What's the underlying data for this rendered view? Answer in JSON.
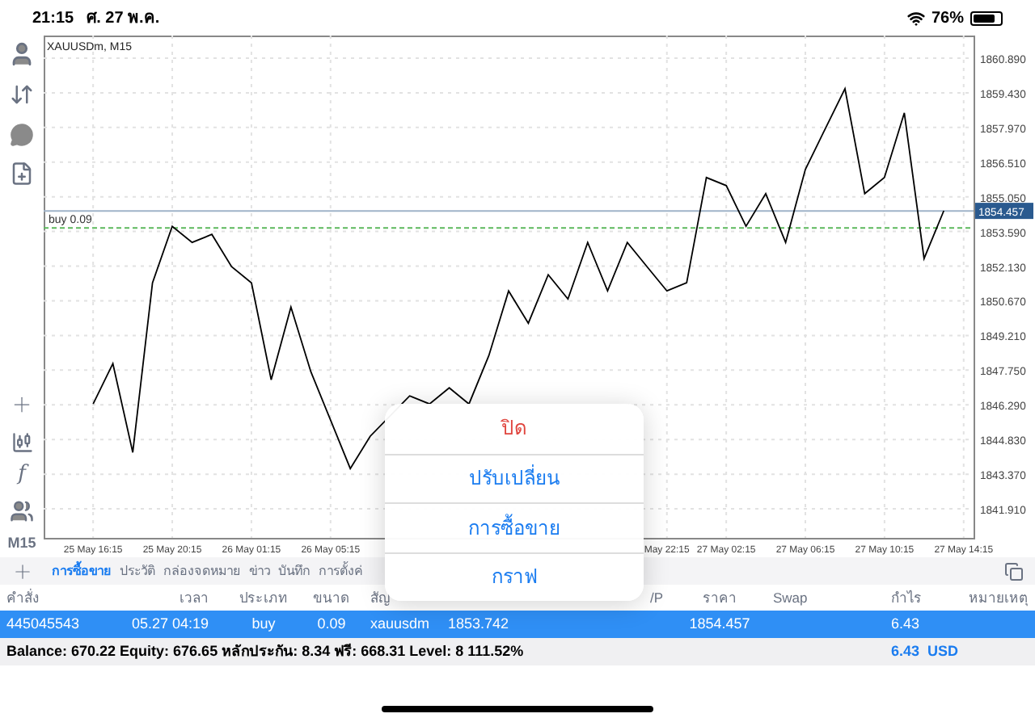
{
  "status_bar": {
    "time": "21:15",
    "date": "ศ. 27 พ.ค.",
    "battery": "76%"
  },
  "left_toolbar": {
    "function_glyph": "f",
    "timeframe": "M15"
  },
  "chart": {
    "chart_data": {
      "type": "line",
      "title": "XAUUSDm, M15",
      "categories": [
        null,
        null,
        "25 May 16:15",
        null,
        null,
        null,
        "25 May 20:15",
        null,
        null,
        null,
        "26 May 01:15",
        null,
        null,
        null,
        "26 May 05:15",
        null,
        null,
        null,
        null,
        null,
        null,
        null,
        null,
        null,
        null,
        null,
        null,
        null,
        null,
        null,
        null,
        "May 22:15",
        null,
        null,
        "27 May 02:15",
        null,
        null,
        null,
        "27 May 06:15",
        null,
        null,
        null,
        "27 May 10:15",
        null,
        null,
        null,
        "27 May 14:15"
      ],
      "series": [
        {
          "color": "#000000",
          "values": [
            null,
            null,
            1846.33,
            1848.03,
            1844.29,
            1851.43,
            1853.81,
            1853.13,
            1853.47,
            1852.11,
            1851.43,
            1847.35,
            1850.41,
            1847.69,
            1845.65,
            1843.61,
            1844.97,
            null,
            1846.67,
            1846.33,
            1847.01,
            1846.33,
            1848.37,
            1851.09,
            1849.73,
            1851.77,
            1850.75,
            1853.13,
            1851.09,
            1853.13,
            1852.11,
            1851.09,
            1851.43,
            1855.86,
            1855.52,
            1853.81,
            1855.18,
            1853.13,
            1856.2,
            1857.9,
            1859.6,
            1855.18,
            1855.86,
            1858.58,
            1852.45,
            1854.46,
            null
          ]
        }
      ],
      "ylim": [
        1840.69,
        1861.84
      ],
      "grid": true,
      "ref_lines": [
        {
          "axis": "y",
          "value": 1853.742,
          "color": "#5cb85c"
        },
        {
          "axis": "y",
          "value": 1854.457,
          "color": "#9fb3c8"
        }
      ],
      "yticks": [
        {
          "value": 1860.89,
          "label": "1860.890"
        },
        {
          "value": 1859.43,
          "label": "1859.430"
        },
        {
          "value": 1857.97,
          "label": "1857.970"
        },
        {
          "value": 1856.51,
          "label": "1856.510"
        },
        {
          "value": 1855.05,
          "label": "1855.050"
        },
        {
          "value": 1853.59,
          "label": "1853.590"
        },
        {
          "value": 1852.13,
          "label": "1852.130"
        },
        {
          "value": 1850.67,
          "label": "1850.670"
        },
        {
          "value": 1849.21,
          "label": "1849.210"
        },
        {
          "value": 1847.75,
          "label": "1847.750"
        },
        {
          "value": 1846.29,
          "label": "1846.290"
        },
        {
          "value": 1844.83,
          "label": "1844.830"
        },
        {
          "value": 1843.37,
          "label": "1843.370"
        },
        {
          "value": 1841.91,
          "label": "1841.910"
        }
      ],
      "annotations": [
        "buy 0.09",
        "1854.457"
      ]
    }
  },
  "tabs": [
    {
      "label": "การซื้อขาย",
      "selected": true
    },
    {
      "label": "ประวัติ",
      "selected": false
    },
    {
      "label": "กล่องจดหมาย",
      "selected": false
    },
    {
      "label": "ข่าว",
      "selected": false
    },
    {
      "label": "บันทึก",
      "selected": false
    },
    {
      "label": "การตั้งค่",
      "selected": false
    }
  ],
  "table": {
    "columns": [
      "คำสั่ง",
      "เวลา",
      "ประเภท",
      "ขนาด",
      "สัญ",
      null,
      null,
      "/P",
      "ราคา",
      "Swap",
      "กำไร",
      "หมายเหตุ"
    ],
    "rows": [
      {
        "selected": true,
        "cells": [
          "445045543",
          "05.27 04:19",
          "buy",
          "0.09",
          "xauusdm",
          "1853.742",
          null,
          null,
          "1854.457",
          null,
          "6.43",
          null
        ]
      }
    ]
  },
  "summary": {
    "text": "Balance: 670.22 Equity: 676.65 หลักประกัน: 8.34 ฟรี: 668.31 Level: 8 111.52%",
    "total": "6.43  USD"
  },
  "menu": [
    {
      "label": "ปิด",
      "kind": "destructive"
    },
    {
      "label": "ปรับเปลี่ยน",
      "kind": "default"
    },
    {
      "label": "การซื้อขาย",
      "kind": "default"
    },
    {
      "label": "กราฟ",
      "kind": "default"
    }
  ]
}
